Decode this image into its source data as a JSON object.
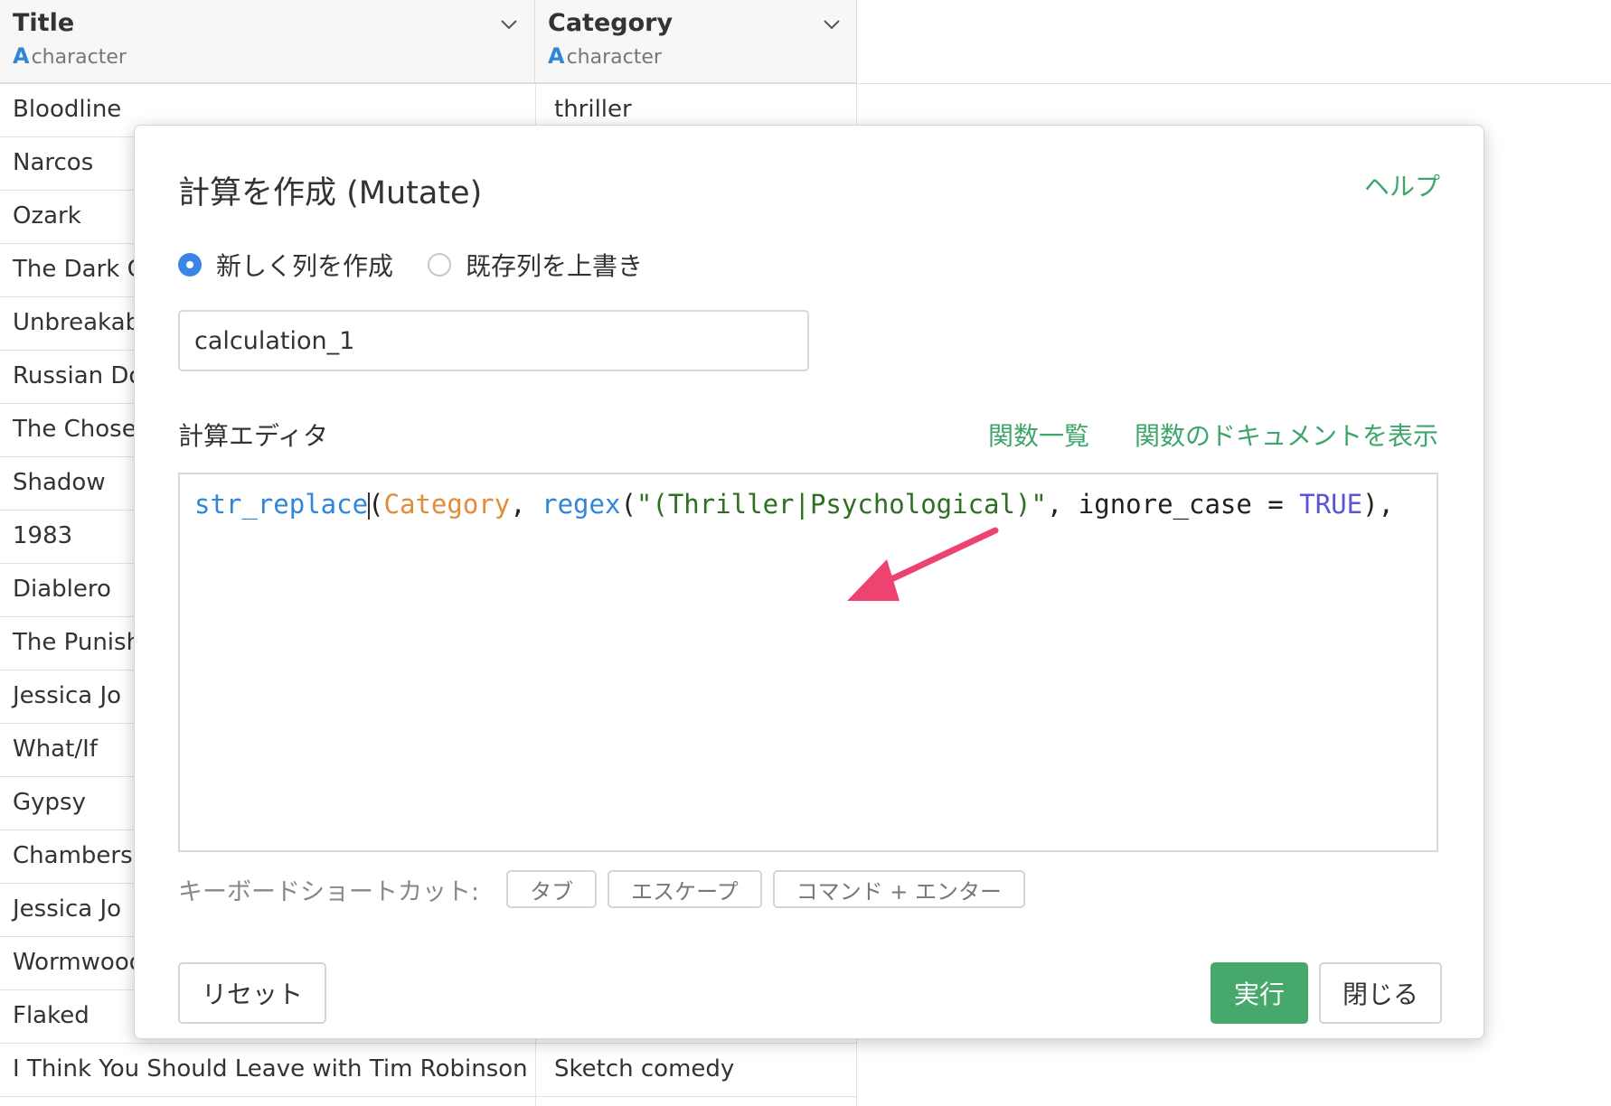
{
  "table": {
    "columns": [
      {
        "name": "Title",
        "type_icon": "A",
        "type": "character"
      },
      {
        "name": "Category",
        "type_icon": "A",
        "type": "character"
      }
    ],
    "rows": [
      {
        "title": "Bloodline",
        "category": "thriller"
      },
      {
        "title": "Narcos",
        "category": ""
      },
      {
        "title": "Ozark",
        "category": ""
      },
      {
        "title": "The Dark C",
        "category": ""
      },
      {
        "title": "Unbreakab",
        "category": ""
      },
      {
        "title": "Russian Do",
        "category": ""
      },
      {
        "title": "The Chose",
        "category": ""
      },
      {
        "title": "Shadow",
        "category": ""
      },
      {
        "title": "1983",
        "category": ""
      },
      {
        "title": "Diablero",
        "category": ""
      },
      {
        "title": "The Punish",
        "category": ""
      },
      {
        "title": "Jessica Jo",
        "category": ""
      },
      {
        "title": "What/If",
        "category": ""
      },
      {
        "title": "Gypsy",
        "category": ""
      },
      {
        "title": "Chambers",
        "category": ""
      },
      {
        "title": "Jessica Jo",
        "category": ""
      },
      {
        "title": "Wormwood",
        "category": ""
      },
      {
        "title": "Flaked",
        "category": ""
      },
      {
        "title": "I Think You Should Leave with Tim Robinson",
        "category": "Sketch comedy"
      }
    ]
  },
  "modal": {
    "title": "計算を作成 (Mutate)",
    "help_link": "ヘルプ",
    "radio_options": [
      {
        "label": "新しく列を作成",
        "selected": true
      },
      {
        "label": "既存列を上書き",
        "selected": false
      }
    ],
    "column_name_value": "calculation_1",
    "editor_label": "計算エディタ",
    "function_list_link": "関数一覧",
    "function_docs_link": "関数のドキュメントを表示",
    "code_tokens": {
      "fn1": "str_replace",
      "open1": "(",
      "col": "Category",
      "sep1": ", ",
      "fn2": "regex",
      "open2": "(",
      "str": "\"(Thriller|Psychological)\"",
      "sep2": ", ignore_case = ",
      "bool": "TRUE",
      "close": "),"
    },
    "shortcuts_label": "キーボードショートカット:",
    "shortcut_keys": [
      "タブ",
      "エスケープ",
      "コマンド + エンター"
    ],
    "reset_label": "リセット",
    "run_label": "実行",
    "close_label": "閉じる"
  },
  "colors": {
    "accent_green": "#46a86b",
    "link_green": "#3ea56b",
    "radio_blue": "#3a86e6",
    "annotation_arrow": "#ee4370"
  },
  "icons": {
    "column_menu": "chevron-down-icon",
    "annotation": "arrow-pointer-icon"
  }
}
